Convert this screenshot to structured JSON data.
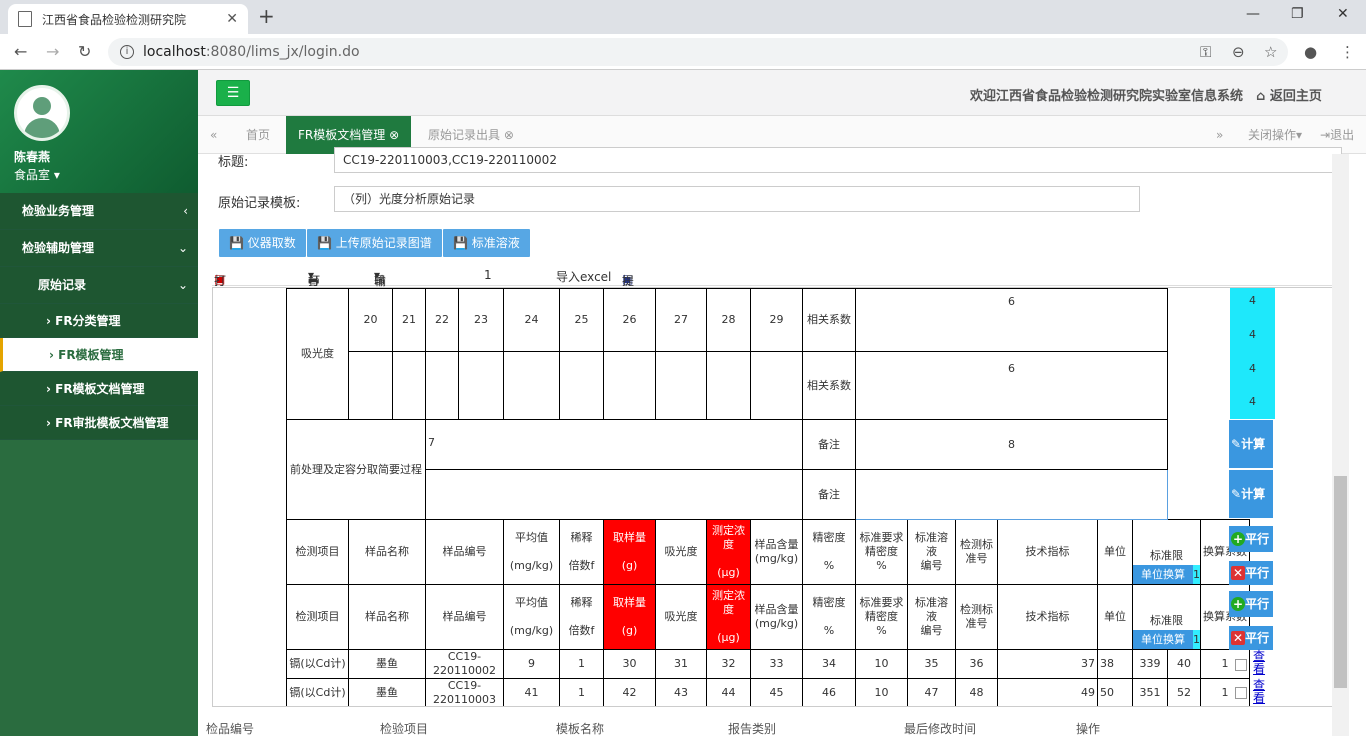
{
  "browser": {
    "tab_title": "江西省食品检验检测研究院",
    "url_host": "localhost",
    "url_rest": ":8080/lims_jx/login.do"
  },
  "user": {
    "name": "陈春燕",
    "dept": "食品室 ▾"
  },
  "menu": [
    {
      "label": "检验业务管理",
      "arrow": "‹"
    },
    {
      "label": "检验辅助管理",
      "arrow": "⌄"
    },
    {
      "label": "原始记录",
      "arrow": "⌄"
    },
    {
      "label": "› FR分类管理"
    },
    {
      "label": "› FR模板管理"
    },
    {
      "label": "› FR模板文档管理"
    },
    {
      "label": "› FR审批模板文档管理"
    }
  ],
  "header": {
    "welcome": "欢迎江西省食品检验检测研究院实验室信息系统",
    "home": "返回主页"
  },
  "tabs": {
    "home": "首页",
    "active": "FR模板文档管理",
    "other": "原始记录出具",
    "close_ops": "关闭操作",
    "logout": "退出"
  },
  "form": {
    "title_label": "标题:",
    "title_value": "CC19-220110003,CC19-220110002",
    "template_label": "原始记录模板:",
    "template_value": "（列）光度分析原始记录"
  },
  "buttons": {
    "b1": "仪器取数",
    "b2": "上传原始记录图谱",
    "b3": "标准溶液"
  },
  "toolbar": {
    "print_client": "打印[客户端]",
    "print": "打印",
    "export": "输出",
    "page": "1",
    "import": "导入excel",
    "submit": "提交"
  },
  "sheet": {
    "absorbance": "吸光度",
    "nums": [
      "20",
      "21",
      "22",
      "23",
      "24",
      "25",
      "26",
      "27",
      "28",
      "29"
    ],
    "corr": "相关系数",
    "corr_v1": "6",
    "corr_v2": "6",
    "pre": "前处理及定容分取简要过程",
    "pre_v": "7",
    "remark": "备注",
    "remark_v": "8",
    "cyan_vals": [
      "4",
      "4",
      "4",
      "4"
    ],
    "calc": "计算",
    "parallel_add": "平行",
    "parallel_del": "平行",
    "hdr": {
      "item": "检测项目",
      "sname": "样品名称",
      "sno": "样品编号",
      "avg": "平均值",
      "avg_u": "(mg/kg)",
      "dil": "稀释",
      "dil2": "倍数f",
      "take": "取样量",
      "take_u": "(g)",
      "abs": "吸光度",
      "conc": "测定浓度",
      "conc_u": "(μg)",
      "content": "样品含量",
      "content_u": "(mg/kg)",
      "prec": "精密度",
      "prec_u": "%",
      "req": "标准要求精密度",
      "req_u": "%",
      "solution": "标准溶液",
      "solution_u": "编号",
      "std": "检测标准号",
      "tech": "技术指标",
      "unit": "单位",
      "limit": "标准限",
      "unit_conv": "单位换算",
      "unit_conv_v": "1",
      "factor": "换算系数"
    },
    "rows": [
      {
        "item": "镉(以Cd计)",
        "name": "墨鱼",
        "no": "CC19-220110002",
        "avg": "9",
        "dil": "1",
        "take": "30",
        "abs": "31",
        "conc": "32",
        "content": "33",
        "prec": "34",
        "req": "10",
        "sol": "35",
        "std": "36",
        "tech": "37",
        "unit": "38",
        "limit": "339",
        "x": "40",
        "f": "1",
        "view": "查看"
      },
      {
        "item": "镉(以Cd计)",
        "name": "墨鱼",
        "no": "CC19-220110003",
        "avg": "41",
        "dil": "1",
        "take": "42",
        "abs": "43",
        "conc": "44",
        "content": "45",
        "prec": "46",
        "req": "10",
        "sol": "47",
        "std": "48",
        "tech": "49",
        "unit": "50",
        "limit": "351",
        "x": "52",
        "f": "1",
        "view": "查看"
      }
    ]
  },
  "bottom": {
    "c1": "检品编号",
    "c2": "检验项目",
    "c3": "模板名称",
    "c4": "报告类别",
    "c5": "最后修改时间",
    "c6": "操作"
  }
}
